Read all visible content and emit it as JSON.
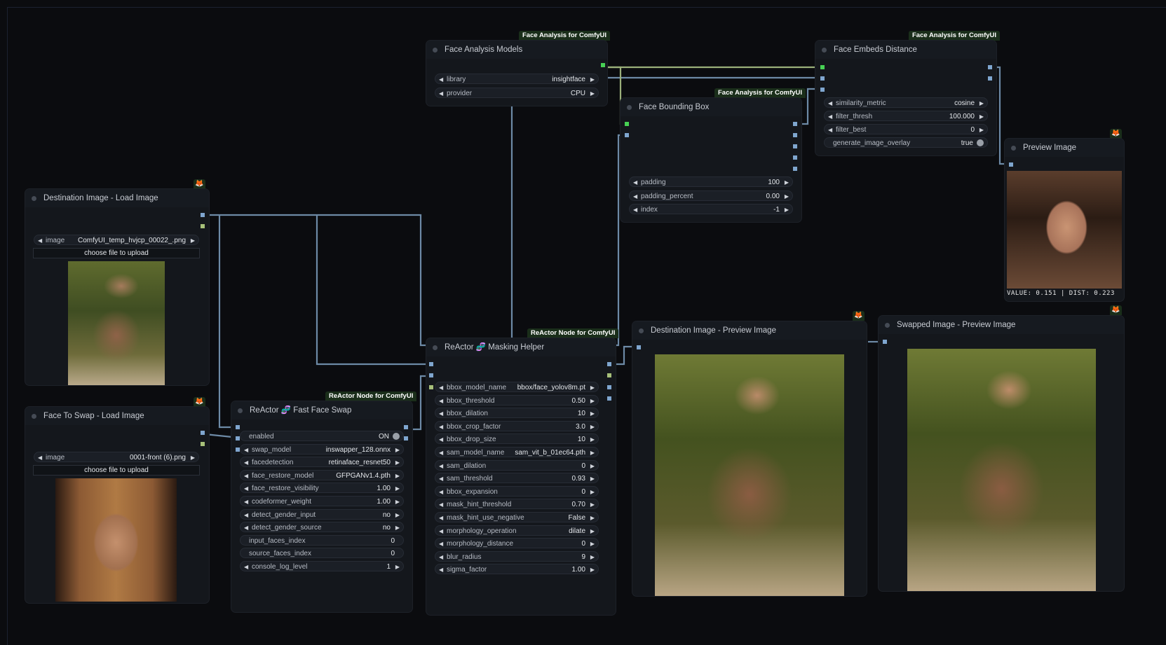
{
  "colors": {
    "canvas": "#0b0c0f",
    "node_bg": "#14171c",
    "wire_image": "#6d8aa6",
    "wire_model": "#9bb07a",
    "slot_image": "#7fa6cf",
    "slot_green": "#47d154",
    "slot_mask": "#a7c07a",
    "fox": "#ff8c2b"
  },
  "nodes": {
    "face_analysis_models": {
      "title": "Face Analysis Models",
      "badge": "Face Analysis for ComfyUI",
      "widgets": [
        {
          "label": "library",
          "value": "insightface"
        },
        {
          "label": "provider",
          "value": "CPU"
        }
      ]
    },
    "face_embeds_distance": {
      "title": "Face Embeds Distance",
      "badge": "Face Analysis for ComfyUI",
      "widgets": [
        {
          "label": "similarity_metric",
          "value": "cosine"
        },
        {
          "label": "filter_thresh",
          "value": "100.000"
        },
        {
          "label": "filter_best",
          "value": "0"
        },
        {
          "label": "generate_image_overlay",
          "value": "true"
        }
      ]
    },
    "face_bounding_box": {
      "title": "Face Bounding Box",
      "badge": "Face Analysis for ComfyUI",
      "widgets": [
        {
          "label": "padding",
          "value": "100"
        },
        {
          "label": "padding_percent",
          "value": "0.00"
        },
        {
          "label": "index",
          "value": "-1"
        }
      ]
    },
    "preview_image": {
      "title": "Preview Image",
      "overlay": "VALUE: 0.151 | DIST: 0.223"
    },
    "destination_load": {
      "title": "Destination Image - Load Image",
      "widgets": [
        {
          "label": "image",
          "value": "ComfyUI_temp_hvjcp_00022_.png"
        }
      ],
      "upload": "choose file to upload"
    },
    "face_to_swap_load": {
      "title": "Face To Swap - Load Image",
      "widgets": [
        {
          "label": "image",
          "value": "0001-front (6).png"
        }
      ],
      "upload": "choose file to upload"
    },
    "fast_face_swap": {
      "title": "ReActor 🧬 Fast Face Swap",
      "badge": "ReActor Node for ComfyUI",
      "widgets": [
        {
          "label": "enabled",
          "value": "ON"
        },
        {
          "label": "swap_model",
          "value": "inswapper_128.onnx"
        },
        {
          "label": "facedetection",
          "value": "retinaface_resnet50"
        },
        {
          "label": "face_restore_model",
          "value": "GFPGANv1.4.pth"
        },
        {
          "label": "face_restore_visibility",
          "value": "1.00"
        },
        {
          "label": "codeformer_weight",
          "value": "1.00"
        },
        {
          "label": "detect_gender_input",
          "value": "no"
        },
        {
          "label": "detect_gender_source",
          "value": "no"
        },
        {
          "label": "input_faces_index",
          "value": "0"
        },
        {
          "label": "source_faces_index",
          "value": "0"
        },
        {
          "label": "console_log_level",
          "value": "1"
        }
      ]
    },
    "masking_helper": {
      "title": "ReActor 🧬 Masking Helper",
      "badge": "ReActor Node for ComfyUI",
      "widgets": [
        {
          "label": "bbox_model_name",
          "value": "bbox/face_yolov8m.pt"
        },
        {
          "label": "bbox_threshold",
          "value": "0.50"
        },
        {
          "label": "bbox_dilation",
          "value": "10"
        },
        {
          "label": "bbox_crop_factor",
          "value": "3.0"
        },
        {
          "label": "bbox_drop_size",
          "value": "10"
        },
        {
          "label": "sam_model_name",
          "value": "sam_vit_b_01ec64.pth"
        },
        {
          "label": "sam_dilation",
          "value": "0"
        },
        {
          "label": "sam_threshold",
          "value": "0.93"
        },
        {
          "label": "bbox_expansion",
          "value": "0"
        },
        {
          "label": "mask_hint_threshold",
          "value": "0.70"
        },
        {
          "label": "mask_hint_use_negative",
          "value": "False"
        },
        {
          "label": "morphology_operation",
          "value": "dilate"
        },
        {
          "label": "morphology_distance",
          "value": "0"
        },
        {
          "label": "blur_radius",
          "value": "9"
        },
        {
          "label": "sigma_factor",
          "value": "1.00"
        }
      ]
    },
    "destination_preview": {
      "title": "Destination Image - Preview Image"
    },
    "swapped_preview": {
      "title": "Swapped Image - Preview Image"
    }
  }
}
